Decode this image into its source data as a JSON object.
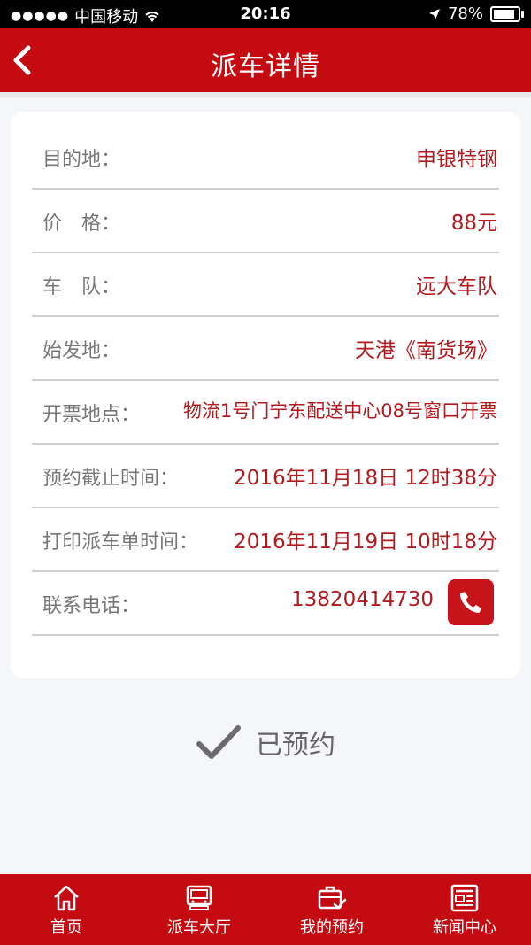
{
  "status_bar": {
    "carrier": "中国移动",
    "time": "20:16",
    "battery": "78%",
    "battery_level": 0.78
  },
  "header": {
    "title": "派车详情"
  },
  "details": [
    {
      "label": "目的地：",
      "value": "申银特钢"
    },
    {
      "label": "价　格：",
      "value": "88元"
    },
    {
      "label": "车　队：",
      "value": "远大车队"
    },
    {
      "label": "始发地：",
      "value": "天港《南货场》"
    },
    {
      "label": "开票地点：",
      "value": "物流1号门宁东配送中心08号窗口开票"
    },
    {
      "label": "预约截止时间：",
      "value": "2016年11月18日 12时38分"
    },
    {
      "label": "打印派车单时间：",
      "value": "2016年11月19日 10时18分"
    },
    {
      "label": "联系电话：",
      "value": "13820414730"
    }
  ],
  "reserved_label": "已预约",
  "tabs": [
    {
      "label": "首页",
      "icon": "home-icon"
    },
    {
      "label": "派车大厅",
      "icon": "truck-icon"
    },
    {
      "label": "我的预约",
      "icon": "briefcase-check-icon"
    },
    {
      "label": "新闻中心",
      "icon": "newspaper-icon"
    }
  ],
  "colors": {
    "brand_red": "#c40b12",
    "value_red": "#b11a1f"
  }
}
